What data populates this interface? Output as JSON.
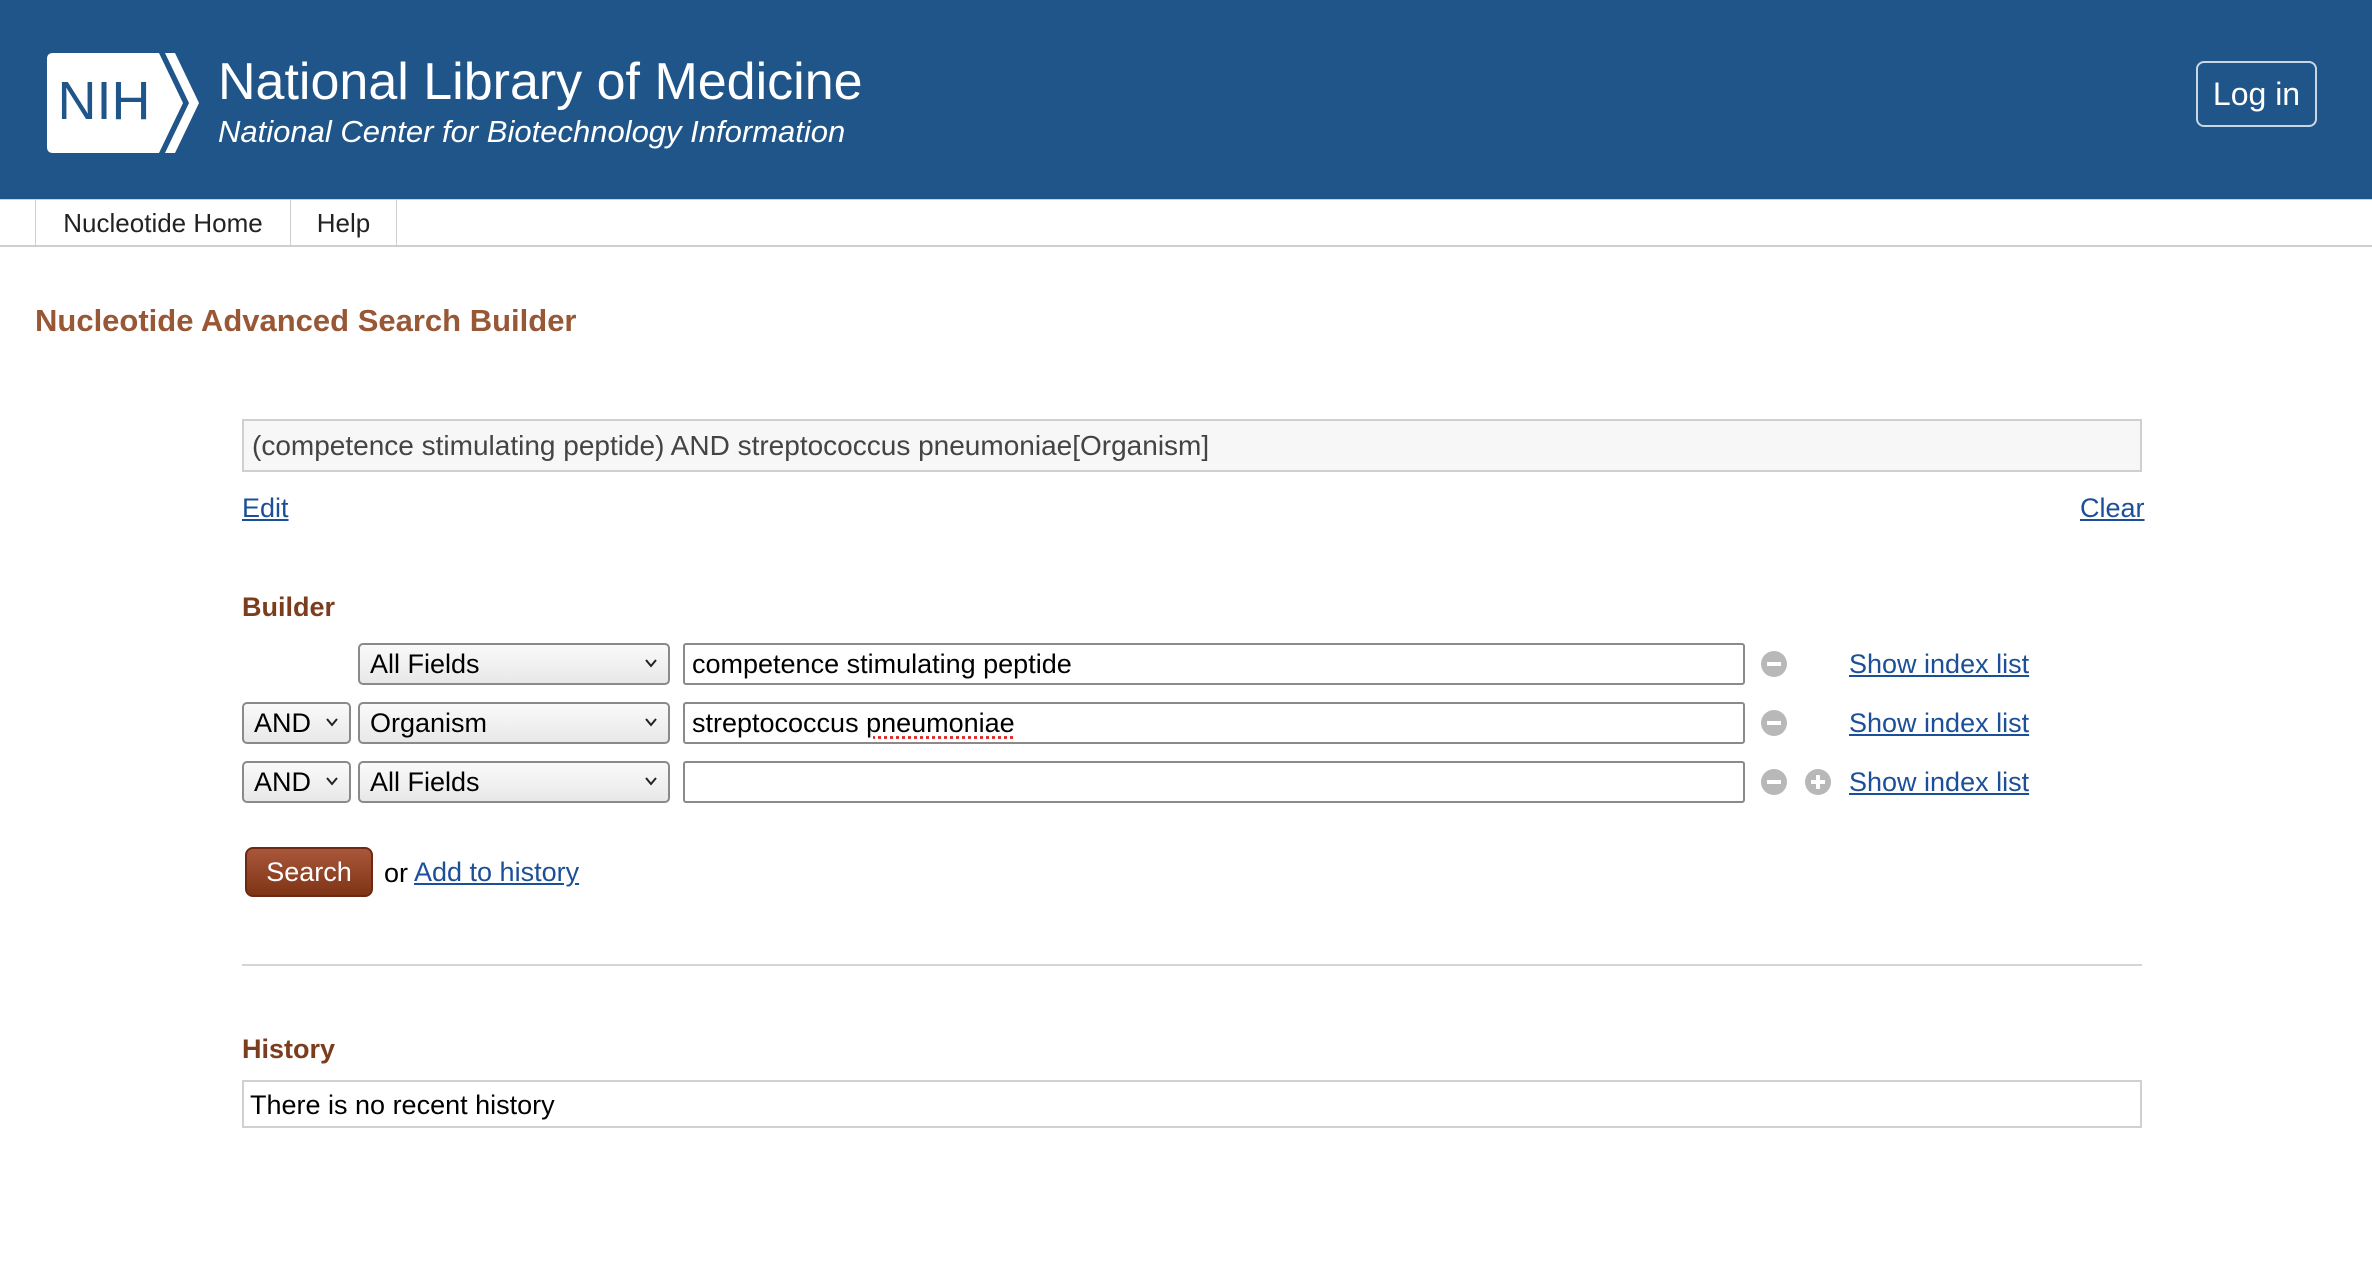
{
  "header": {
    "logo_badge_text": "NIH",
    "title": "National Library of Medicine",
    "subtitle": "National Center for Biotechnology Information",
    "login_label": "Log in",
    "background_color": "#20558a"
  },
  "nav": {
    "tabs": [
      {
        "label": "Nucleotide Home"
      },
      {
        "label": "Help"
      }
    ]
  },
  "page": {
    "title": "Nucleotide Advanced Search Builder"
  },
  "query": {
    "text": "(competence stimulating peptide) AND streptococcus pneumoniae[Organism]",
    "edit_label": "Edit",
    "clear_label": "Clear"
  },
  "builder": {
    "label": "Builder",
    "rows": [
      {
        "bool": "",
        "field": "All Fields",
        "term_before": "competence stimulating peptide",
        "term_misspelled": "",
        "term_after": "",
        "index_link": "Show index list",
        "icons": [
          "minus-circle-icon"
        ]
      },
      {
        "bool": "AND",
        "field": "Organism",
        "term_before": "streptococcus ",
        "term_misspelled": "pneumoniae",
        "term_after": "",
        "index_link": "Show index list",
        "icons": [
          "minus-circle-icon"
        ]
      },
      {
        "bool": "AND",
        "field": "All Fields",
        "term_before": "",
        "term_misspelled": "",
        "term_after": "",
        "index_link": "Show index list",
        "icons": [
          "minus-circle-icon",
          "plus-circle-icon"
        ]
      }
    ],
    "search_label": "Search",
    "or_text": "or",
    "add_history_label": "Add to history"
  },
  "history": {
    "label": "History",
    "empty_text": "There is no recent history"
  },
  "colors": {
    "title_brown": "#985735",
    "link_blue": "#1b4f98",
    "search_button": "#8c3e1f"
  }
}
